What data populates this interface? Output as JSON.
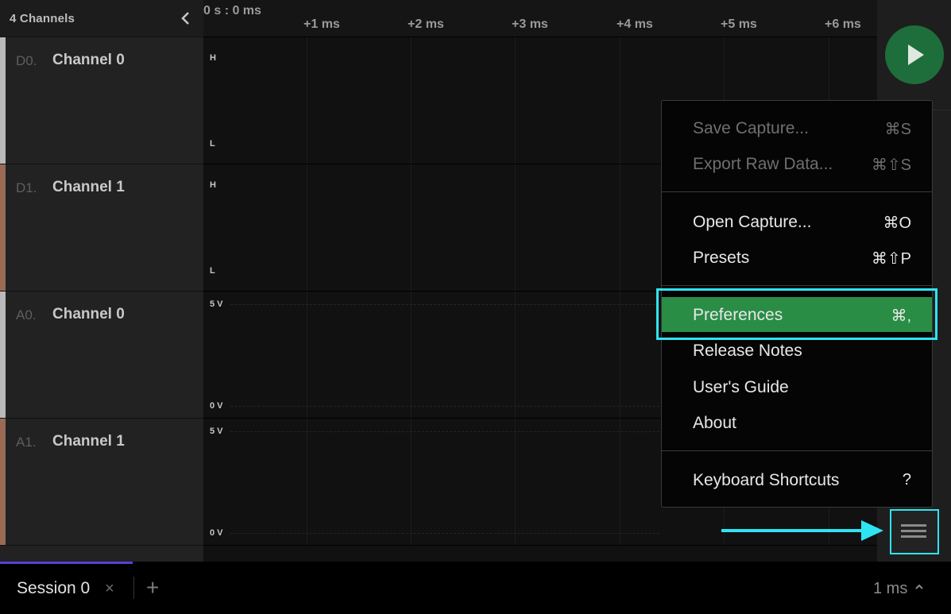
{
  "sidebar": {
    "title": "4 Channels",
    "collapse_icon": "chevron-left-icon",
    "channels": [
      {
        "id": "D0.",
        "name": "Channel 0",
        "color": "#b9b9b9"
      },
      {
        "id": "D1.",
        "name": "Channel 1",
        "color": "#9a6a55"
      },
      {
        "id": "A0.",
        "name": "Channel 0",
        "color": "#b9b9b9"
      },
      {
        "id": "A1.",
        "name": "Channel 1",
        "color": "#9a6a55"
      }
    ]
  },
  "timeline": {
    "origin": "0 s : 0 ms",
    "ticks": [
      "+1 ms",
      "+2 ms",
      "+3 ms",
      "+4 ms",
      "+5 ms",
      "+6 ms"
    ]
  },
  "levels": {
    "digital_high": "H",
    "digital_low": "L",
    "analog_high": "5 V",
    "analog_low": "0 V"
  },
  "rail": {
    "play_icon": "play-icon",
    "menu_icon": "hamburger-menu-icon"
  },
  "menu": {
    "items": [
      {
        "label": "Save Capture...",
        "key": "⌘S",
        "state": "disabled"
      },
      {
        "label": "Export Raw Data...",
        "key": "⌘⇧S",
        "state": "disabled"
      },
      {
        "label": "Open Capture...",
        "key": "⌘O",
        "state": "enabled"
      },
      {
        "label": "Presets",
        "key": "⌘⇧P",
        "state": "enabled"
      },
      {
        "label": "Preferences",
        "key": "⌘,",
        "state": "highlighted"
      },
      {
        "label": "Release Notes",
        "key": "",
        "state": "enabled"
      },
      {
        "label": "User's Guide",
        "key": "",
        "state": "enabled"
      },
      {
        "label": "About",
        "key": "",
        "state": "enabled"
      },
      {
        "label": "Keyboard Shortcuts",
        "key": "?",
        "state": "enabled"
      }
    ]
  },
  "bottom": {
    "tab_label": "Session 0",
    "tab_close": "×",
    "add_tab": "+",
    "zoom": "1 ms",
    "zoom_icon": "chevron-up-icon"
  },
  "colors": {
    "accent_highlight": "#2fe4f2",
    "menu_active": "#2a8d45",
    "play_button": "#1e6e3c",
    "session_tab_accent": "#5b3fd6"
  }
}
